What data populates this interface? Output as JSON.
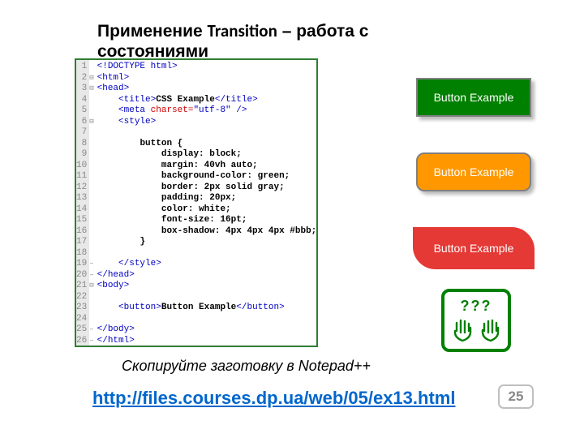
{
  "heading_part1": "Применение ",
  "heading_transition": "Transition",
  "heading_part2": " – работа с состояниями",
  "code": {
    "line_numbers": [
      "1",
      "2",
      "3",
      "4",
      "5",
      "6",
      "7",
      "8",
      "9",
      "10",
      "11",
      "12",
      "13",
      "14",
      "15",
      "16",
      "17",
      "18",
      "19",
      "20",
      "21",
      "22",
      "23",
      "24",
      "25",
      "26"
    ],
    "fold_marks": [
      "",
      "⊟",
      "⊟",
      "",
      "",
      "⊟",
      "",
      "",
      "",
      "",
      "",
      "",
      "",
      "",
      "",
      "",
      "",
      "",
      "–",
      "–",
      "⊟",
      "",
      "",
      "",
      "–",
      "–"
    ],
    "lines": [
      {
        "pre": "",
        "tag": "<!DOCTYPE html>",
        "rest": ""
      },
      {
        "pre": "",
        "tag": "<html>",
        "rest": ""
      },
      {
        "pre": "",
        "tag": "<head>",
        "rest": ""
      },
      {
        "pre": "    ",
        "tag": "<title>",
        "txt": "CSS Example",
        "close": "</title>"
      },
      {
        "pre": "    ",
        "tag": "<meta ",
        "attr": "charset=",
        "val": "\"utf-8\"",
        "end": " />"
      },
      {
        "pre": "    ",
        "tag": "<style>",
        "rest": ""
      },
      {
        "pre": "",
        "tag": "",
        "rest": ""
      },
      {
        "pre": "        ",
        "css": "button {"
      },
      {
        "pre": "            ",
        "css": "display: block;"
      },
      {
        "pre": "            ",
        "css": "margin: 40vh auto;"
      },
      {
        "pre": "            ",
        "css": "background-color: green;"
      },
      {
        "pre": "            ",
        "css": "border: 2px solid gray;"
      },
      {
        "pre": "            ",
        "css": "padding: 20px;"
      },
      {
        "pre": "            ",
        "css": "color: white;"
      },
      {
        "pre": "            ",
        "css": "font-size: 16pt;"
      },
      {
        "pre": "            ",
        "css": "box-shadow: 4px 4px 4px #bbb;"
      },
      {
        "pre": "        ",
        "css": "}"
      },
      {
        "pre": "",
        "tag": "",
        "rest": ""
      },
      {
        "pre": "    ",
        "tag": "</style>",
        "rest": ""
      },
      {
        "pre": "",
        "tag": "</head>",
        "rest": ""
      },
      {
        "pre": "",
        "tag": "<body>",
        "rest": ""
      },
      {
        "pre": "",
        "tag": "",
        "rest": ""
      },
      {
        "pre": "    ",
        "tag": "<button>",
        "txt": "Button Example",
        "close": "</button>"
      },
      {
        "pre": "",
        "tag": "",
        "rest": ""
      },
      {
        "pre": "",
        "tag": "</body>",
        "rest": ""
      },
      {
        "pre": "",
        "tag": "</html>",
        "rest": ""
      }
    ]
  },
  "button_label": "Button Example",
  "hands_qmk": "???",
  "instruction": "Скопируйте заготовку в Notepad++",
  "link_text": "http://files.courses.dp.ua/web/05/ex13.html",
  "page_number": "25"
}
